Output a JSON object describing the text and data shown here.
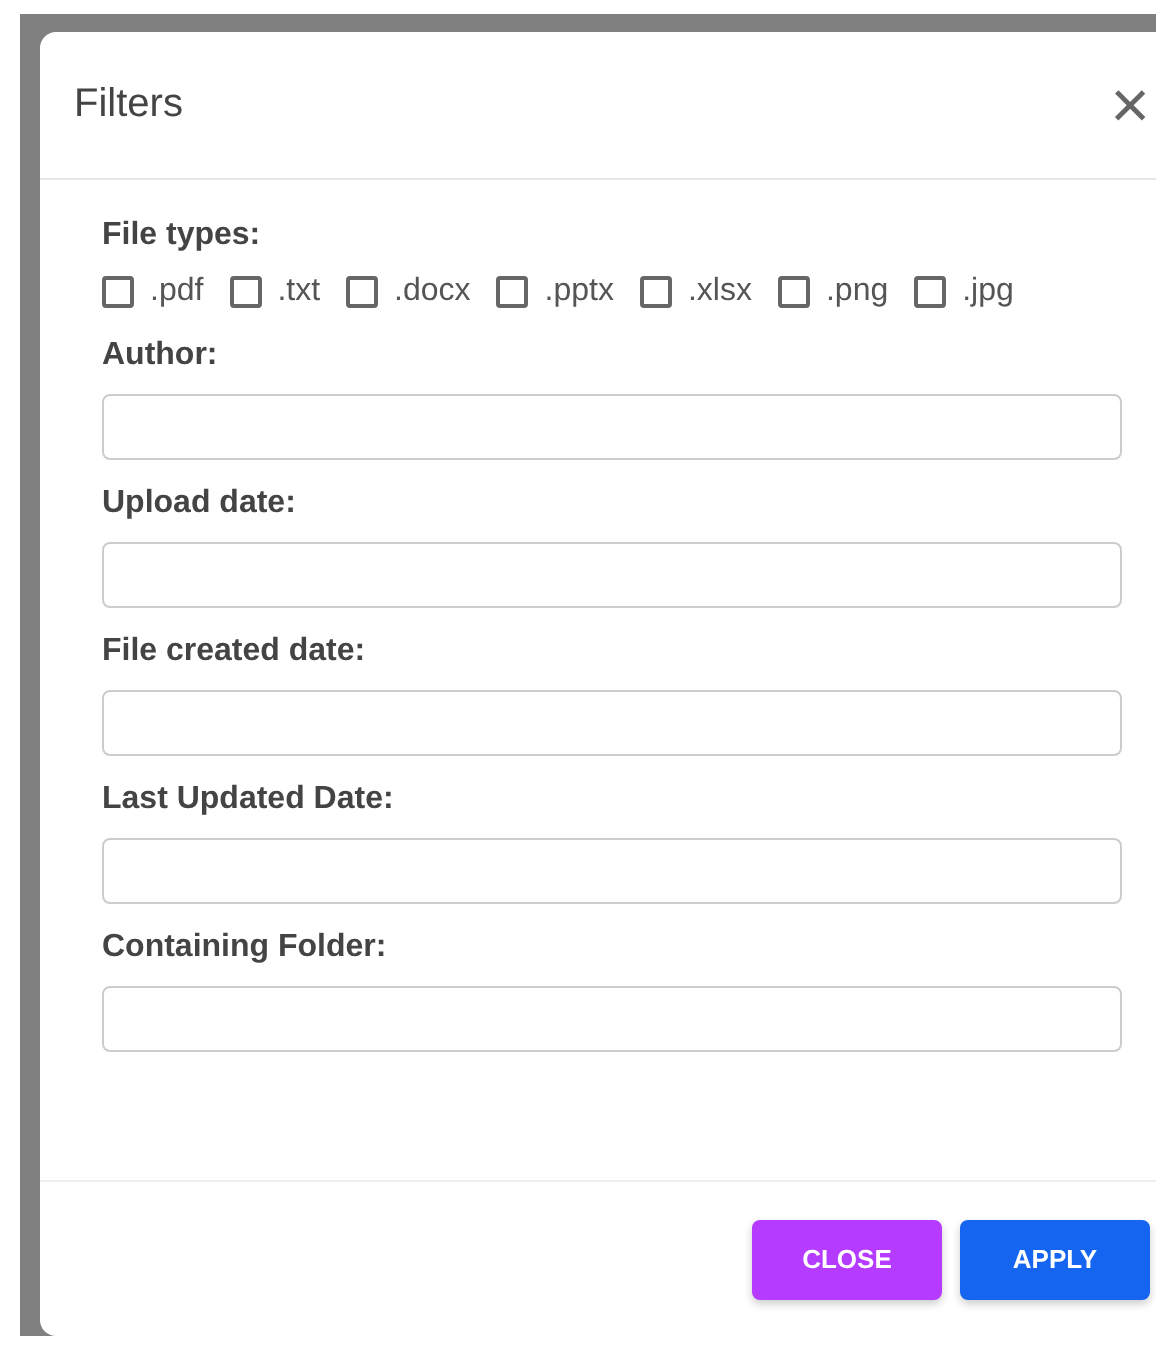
{
  "dialog": {
    "title": "Filters",
    "close_icon": "×",
    "sections": [
      {
        "kind": "checkboxes",
        "label": "File types:",
        "options": [
          {
            "label": ".pdf",
            "checked": false
          },
          {
            "label": ".txt",
            "checked": false
          },
          {
            "label": ".docx",
            "checked": false
          },
          {
            "label": ".pptx",
            "checked": false
          },
          {
            "label": ".xlsx",
            "checked": false
          },
          {
            "label": ".png",
            "checked": false
          },
          {
            "label": ".jpg",
            "checked": false
          }
        ]
      },
      {
        "kind": "field",
        "label": "Author:"
      },
      {
        "kind": "field",
        "label": "Upload date:"
      },
      {
        "kind": "field",
        "label": "File created date:"
      },
      {
        "kind": "field",
        "label": "Last Updated Date:"
      },
      {
        "kind": "field",
        "label": "Containing Folder:"
      }
    ],
    "buttons": [
      {
        "label": "CLOSE",
        "kind": "secondary"
      },
      {
        "label": "APPLY",
        "kind": "primary"
      }
    ]
  }
}
